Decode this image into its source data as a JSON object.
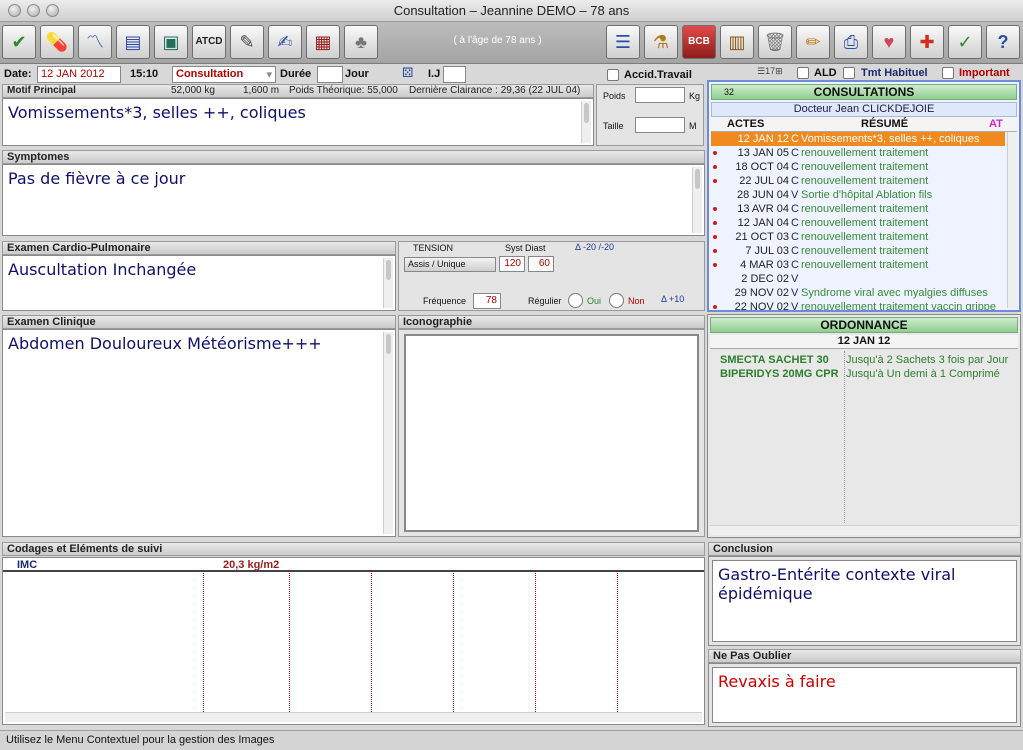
{
  "window": {
    "title": "Consultation – Jeannine DEMO – 78 ans"
  },
  "toolbar": {
    "age_banner": "( à l'âge de 78 ans )",
    "left_icons": [
      "stethoscope-icon",
      "pills-icon",
      "chart-icon",
      "document-icon",
      "screen-icon",
      "atcd-warning-icon",
      "pen-icon",
      "sign-icon",
      "printer-icon",
      "tree-icon"
    ],
    "right_icons": [
      "list-icon",
      "bottles-icon",
      "bcb-icon",
      "book-icon",
      "trash-icon",
      "pencil-icon",
      "print-icon",
      "heart-icon",
      "plus-icon",
      "check-icon",
      "help-icon"
    ],
    "bcb_label": "BCB",
    "atcd_label": "ATCD"
  },
  "form": {
    "date_label": "Date:",
    "date_value": "12 JAN 2012",
    "time_value": "15:10",
    "type_value": "Consultation",
    "duree_label": "Durée",
    "jour_label": "Jour",
    "ij_label": "I.J",
    "accid_label": "Accid.Travail",
    "ald_label": "ALD",
    "tmt_label": "Tmt Habituel",
    "important_label": "Important",
    "page_counter": "17"
  },
  "motif": {
    "header": "Motif Principal",
    "weight": "52,000 kg",
    "height": "1,600 m",
    "poids_theorique": "Poids Théorique: 55,000",
    "clairance": "Dernière Clairance : 29,36 (22 JUL 04)",
    "text": "Vomissements*3, selles ++, coliques"
  },
  "vitals": {
    "poids_label": "Poids",
    "kg_label": "Kg",
    "taille_label": "Taille",
    "m_label": "M"
  },
  "symptomes": {
    "header": "Symptomes",
    "text": "Pas de fièvre à ce jour"
  },
  "cardio": {
    "header": "Examen Cardio-Pulmonaire",
    "text": "Auscultation Inchangée",
    "tension_label": "TENSION",
    "syst_diast_label": "Syst Diast",
    "delta_tension": "Δ -20 /-20",
    "assis_label": "Assis / Unique",
    "syst_value": "120",
    "diast_value": "60",
    "frequence_label": "Fréquence",
    "frequence_value": "78",
    "regulier_label": "Régulier",
    "oui_label": "Oui",
    "non_label": "Non",
    "delta_freq": "Δ +10"
  },
  "clinique": {
    "header": "Examen Clinique",
    "text": "Abdomen Douloureux Météorisme+++"
  },
  "iconographie": {
    "header": "Iconographie"
  },
  "consultations": {
    "count": "32",
    "header": "CONSULTATIONS",
    "doctor": "Docteur Jean CLICKDEJOIE",
    "col_actes": "ACTES",
    "col_resume": "RÉSUMÉ",
    "col_at": "AT",
    "rows": [
      {
        "date": "12 JAN 12",
        "code": "C",
        "summary": "Vomissements*3, selles ++, coliques",
        "dot": false,
        "selected": true
      },
      {
        "date": "13 JAN 05",
        "code": "C",
        "summary": "renouvellement traitement",
        "dot": true,
        "selected": false
      },
      {
        "date": "18 OCT 04",
        "code": "C",
        "summary": "renouvellement traitement",
        "dot": true,
        "selected": false
      },
      {
        "date": "22 JUL 04",
        "code": "C",
        "summary": "renouvellement traitement",
        "dot": true,
        "selected": false
      },
      {
        "date": "28 JUN 04",
        "code": "V",
        "summary": "Sortie d'hôpital Ablation fils",
        "dot": false,
        "selected": false
      },
      {
        "date": "13 AVR 04",
        "code": "C",
        "summary": "renouvellement traitement",
        "dot": true,
        "selected": false
      },
      {
        "date": "12 JAN 04",
        "code": "C",
        "summary": "renouvellement traitement",
        "dot": true,
        "selected": false
      },
      {
        "date": "21 OCT 03",
        "code": "C",
        "summary": "renouvellement traitement",
        "dot": true,
        "selected": false
      },
      {
        "date": "7 JUL 03",
        "code": "C",
        "summary": "renouvellement traitement",
        "dot": true,
        "selected": false
      },
      {
        "date": "4 MAR 03",
        "code": "C",
        "summary": "renouvellement traitement",
        "dot": true,
        "selected": false
      },
      {
        "date": "2 DEC 02",
        "code": "V",
        "summary": "",
        "dot": false,
        "selected": false
      },
      {
        "date": "29 NOV 02",
        "code": "V",
        "summary": "Syndrome viral avec myalgies diffuses",
        "dot": false,
        "selected": false
      },
      {
        "date": "22 NOV 02",
        "code": "V",
        "summary": "renouvellement traitement vaccin grippe",
        "dot": true,
        "selected": false
      }
    ]
  },
  "ordonnance": {
    "header": "ORDONNANCE",
    "date": "12 JAN   12",
    "rows": [
      {
        "med": "SMECTA SACHET 30",
        "posology": "Jusqu'à 2 Sachets 3 fois par Jour"
      },
      {
        "med": "BIPERIDYS 20MG CPR",
        "posology": "Jusqu'à Un demi à 1 Comprimé"
      }
    ]
  },
  "codages": {
    "header": "Codages et Eléments de suivi",
    "label": "IMC",
    "value": "20,3 kg/m2"
  },
  "conclusion": {
    "header": "Conclusion",
    "text": "Gastro-Entérite contexte viral épidémique"
  },
  "nepasoublier": {
    "header": "Ne Pas Oublier",
    "text": "Revaxis à faire"
  },
  "status": {
    "text": "Utilisez le Menu Contextuel pour la gestion des Images"
  }
}
